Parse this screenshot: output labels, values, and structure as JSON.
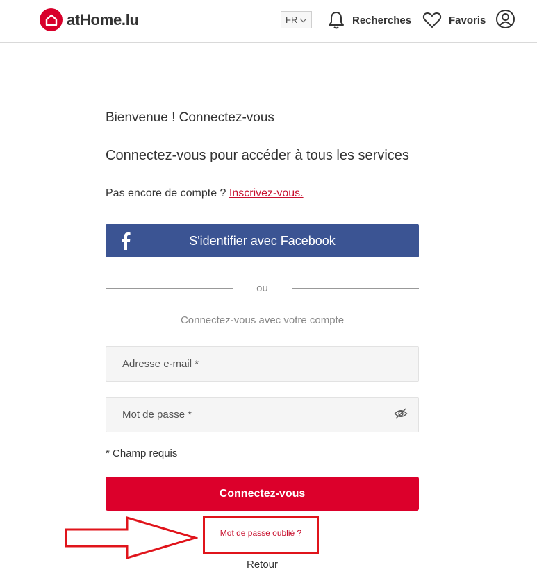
{
  "header": {
    "logo_text": "atHome.lu",
    "language": "FR",
    "searches_label": "Recherches",
    "favorites_label": "Favoris"
  },
  "main": {
    "welcome": "Bienvenue ! Connectez-vous",
    "subtitle": "Connectez-vous pour accéder à tous les services",
    "no_account_text": "Pas encore de compte ?",
    "signup_link": "Inscrivez-vous.",
    "facebook_button": "S'identifier avec Facebook",
    "or_text": "ou",
    "with_account_text": "Connectez-vous avec votre compte",
    "email_placeholder": "Adresse e-mail *",
    "password_placeholder": "Mot de passe *",
    "required_note": "* Champ requis",
    "login_button": "Connectez-vous",
    "forgot_password_link": "Mot de passe oublié ?",
    "back_link": "Retour"
  },
  "colors": {
    "brand_red": "#dc002b",
    "facebook_blue": "#3b5493",
    "link_red": "#c8102e",
    "annotation_red": "#e0141b"
  },
  "icons": {
    "logo": "house-icon",
    "language_dropdown": "chevron-down-icon",
    "searches": "bell-icon",
    "favorites": "heart-icon",
    "account": "user-circle-icon",
    "facebook": "facebook-f-icon",
    "password_toggle": "eye-slash-icon",
    "annotation": "arrow-right-icon"
  }
}
